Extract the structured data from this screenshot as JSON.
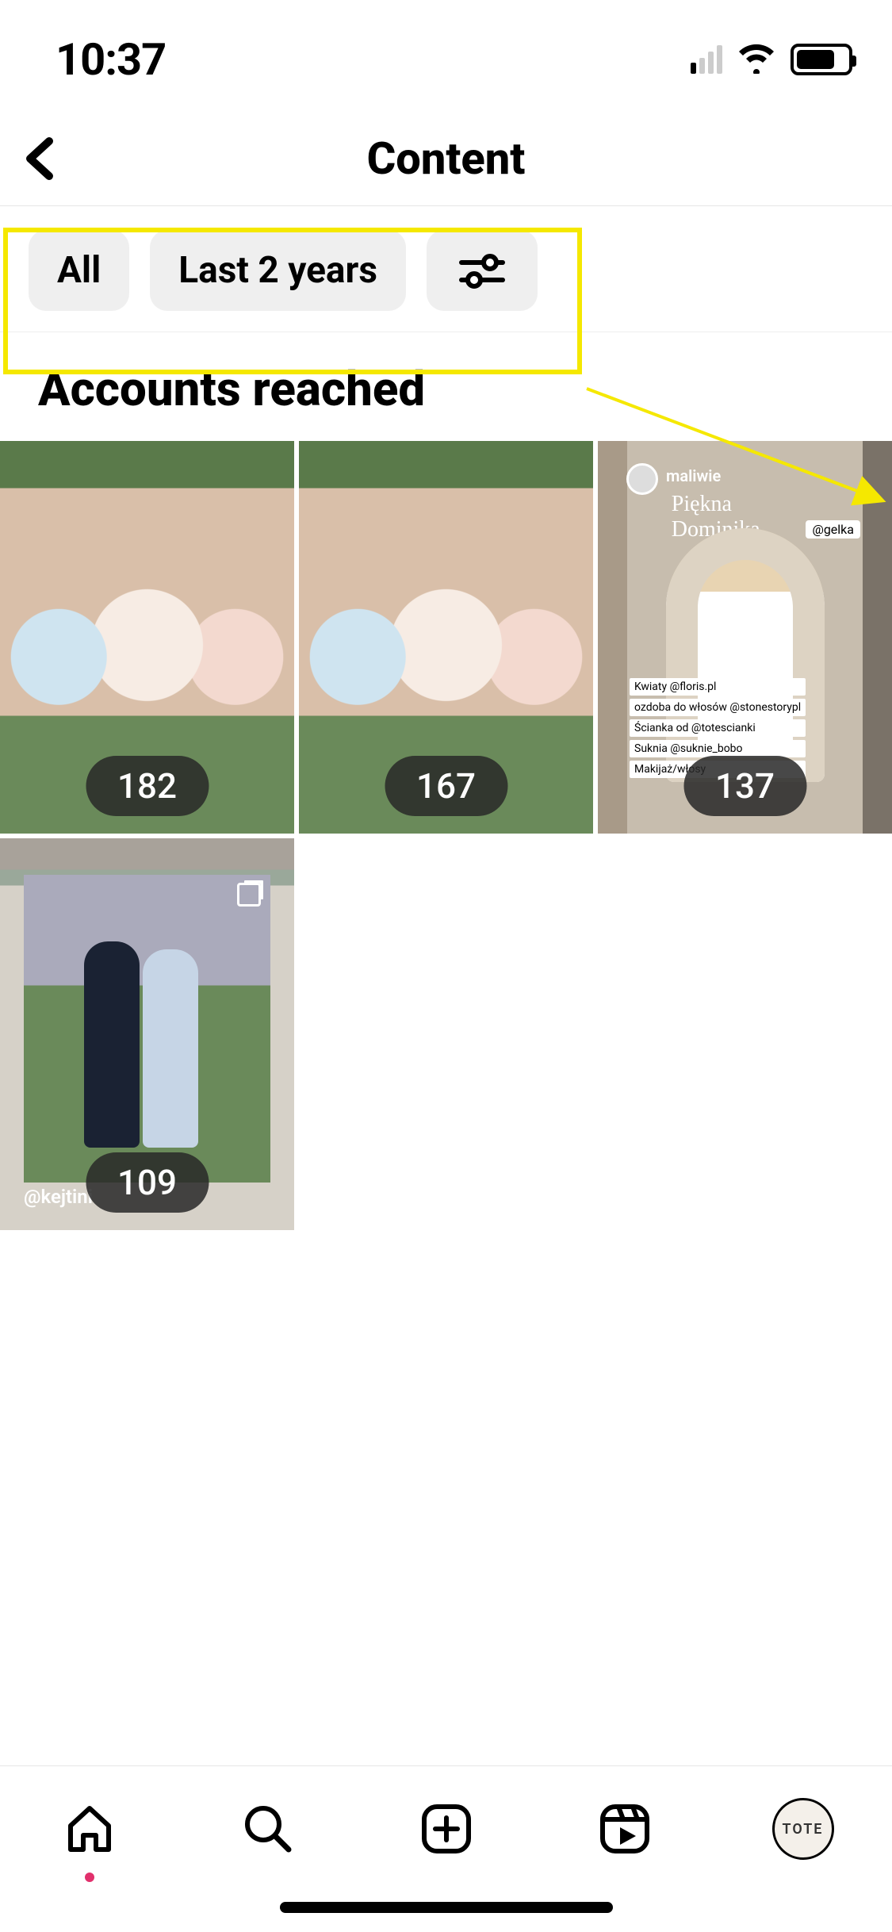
{
  "status": {
    "time": "10:37"
  },
  "header": {
    "title": "Content"
  },
  "filters": {
    "chip_all": "All",
    "chip_range": "Last 2 years"
  },
  "section": {
    "title": "Accounts reached"
  },
  "tiles": [
    {
      "count": "182"
    },
    {
      "count": "167"
    },
    {
      "count": "137",
      "story": {
        "user": "maliwie",
        "title": "Piękna Dominika",
        "tag": "@gelka",
        "captions": [
          "Kwiaty @floris.pl",
          "ozdoba do włosów @stonestorypl",
          "Ścianka od @totescianki",
          "Suknia @suknie_bobo",
          "Makijaż/włosy"
        ]
      }
    },
    {
      "count": "109",
      "tag": "@kejtini"
    }
  ],
  "nav": {
    "avatar_label": "TOTE"
  }
}
